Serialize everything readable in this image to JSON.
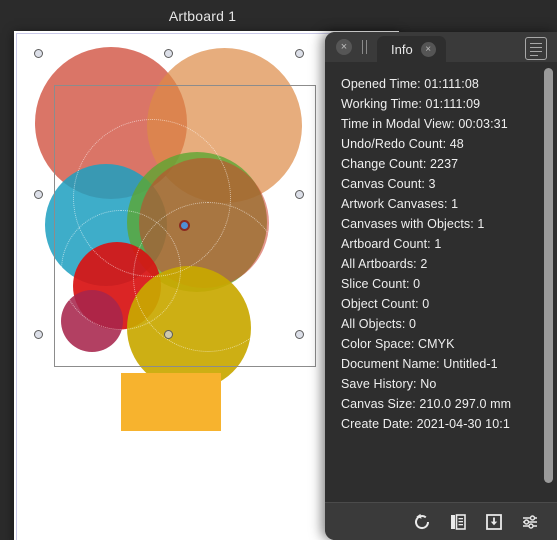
{
  "canvas": {
    "artboard_title": "Artboard 1",
    "shapes": [
      {
        "name": "circle-salmon",
        "color": "#CC6A5B"
      },
      {
        "name": "circle-orange",
        "color": "#DDA071"
      },
      {
        "name": "circle-green",
        "color": "#60A044"
      },
      {
        "name": "circle-teal",
        "color": "#2BA6C2"
      },
      {
        "name": "circle-red",
        "color": "#D81A1A"
      },
      {
        "name": "circle-magenta",
        "color": "#A73055"
      },
      {
        "name": "circle-yellow",
        "color": "#C9A800"
      },
      {
        "name": "rectangle-orange",
        "color": "#F7B32E"
      }
    ],
    "selection": {
      "handle_color": "#DCDFE8",
      "anchor_color": "#4F8FD6",
      "anchor_ring_color": "#8C2B20"
    }
  },
  "panel": {
    "close_label": "×",
    "tab_label": "Info",
    "tab_close_label": "×",
    "menu_icon": "list-menu-icon",
    "rows": [
      "Opened Time: 01:111:08",
      "Working Time: 01:111:09",
      "Time in Modal View: 00:03:31",
      "Undo/Redo Count: 48",
      "Change Count: 2237",
      "Canvas Count: 3",
      "Artwork Canvases: 1",
      "Canvases with Objects: 1",
      "Artboard Count: 1",
      "All Artboards: 2",
      "Slice Count: 0",
      "Object Count: 0",
      "All Objects: 0",
      "Color Space: CMYK",
      "Document Name: Untitled-1",
      "Save History: No",
      "Canvas Size: 210.0 297.0 mm",
      "Create Date: 2021-04-30 10:1"
    ],
    "footer_buttons": [
      {
        "name": "refresh-icon"
      },
      {
        "name": "copy-icon"
      },
      {
        "name": "save-download-icon"
      },
      {
        "name": "settings-sliders-icon"
      }
    ]
  }
}
